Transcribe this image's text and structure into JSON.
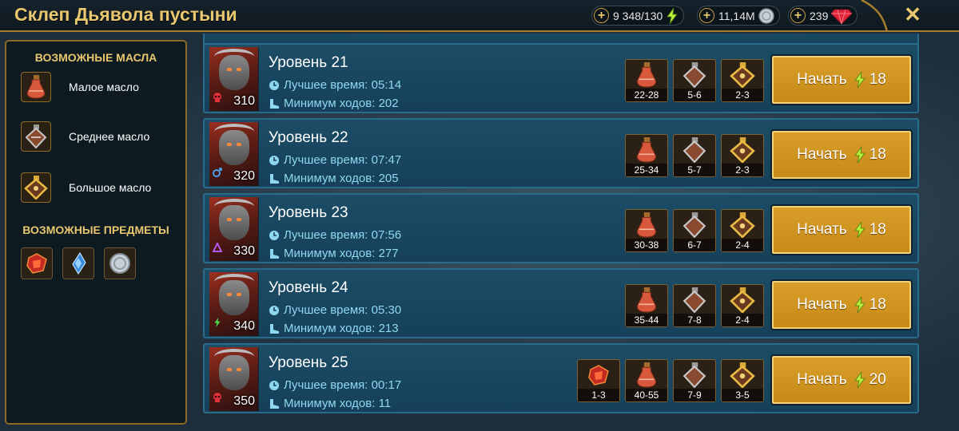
{
  "header": {
    "title": "Склеп Дьявола пустыни",
    "energy": "9 348/130",
    "silver": "11,14M",
    "gems": "239"
  },
  "sidebar": {
    "oils_heading": "ВОЗМОЖНЫЕ МАСЛА",
    "oils": [
      {
        "label": "Малое масло",
        "icon": "small-oil-flask-icon"
      },
      {
        "label": "Среднее масло",
        "icon": "medium-oil-flask-icon"
      },
      {
        "label": "Большое масло",
        "icon": "large-oil-flask-icon"
      }
    ],
    "items_heading": "ВОЗМОЖНЫЕ ПРЕДМЕТЫ",
    "items": [
      "red-artifact-icon",
      "blue-shard-icon",
      "silver-coin-icon"
    ]
  },
  "levels": [
    {
      "title": "Уровень 21",
      "power": "310",
      "affinity": "skull",
      "best_time": "Лучшее время: 05:14",
      "min_turns": "Минимум ходов: 202",
      "drops": [
        "22-28",
        "5-6",
        "2-3"
      ],
      "has_artifact": false,
      "start_label": "Начать",
      "cost": "18"
    },
    {
      "title": "Уровень 22",
      "power": "320",
      "affinity": "magic",
      "best_time": "Лучшее время: 07:47",
      "min_turns": "Минимум ходов: 205",
      "drops": [
        "25-34",
        "5-7",
        "2-3"
      ],
      "has_artifact": false,
      "start_label": "Начать",
      "cost": "18"
    },
    {
      "title": "Уровень 23",
      "power": "330",
      "affinity": "spirit",
      "best_time": "Лучшее время: 07:56",
      "min_turns": "Минимум ходов: 277",
      "drops": [
        "30-38",
        "6-7",
        "2-4"
      ],
      "has_artifact": false,
      "start_label": "Начать",
      "cost": "18"
    },
    {
      "title": "Уровень 24",
      "power": "340",
      "affinity": "force",
      "best_time": "Лучшее время: 05:30",
      "min_turns": "Минимум ходов: 213",
      "drops": [
        "35-44",
        "7-8",
        "2-4"
      ],
      "has_artifact": false,
      "start_label": "Начать",
      "cost": "18"
    },
    {
      "title": "Уровень 25",
      "power": "350",
      "affinity": "skull",
      "best_time": "Лучшее время: 00:17",
      "min_turns": "Минимум ходов: 11",
      "artifact_drop": "1-3",
      "drops": [
        "40-55",
        "7-9",
        "3-5"
      ],
      "has_artifact": true,
      "start_label": "Начать",
      "cost": "20"
    }
  ],
  "colors": {
    "gold": "#e9c76e",
    "row_bg": "#1a4761",
    "stat_text": "#8fd7f0",
    "button": "#d39625"
  }
}
